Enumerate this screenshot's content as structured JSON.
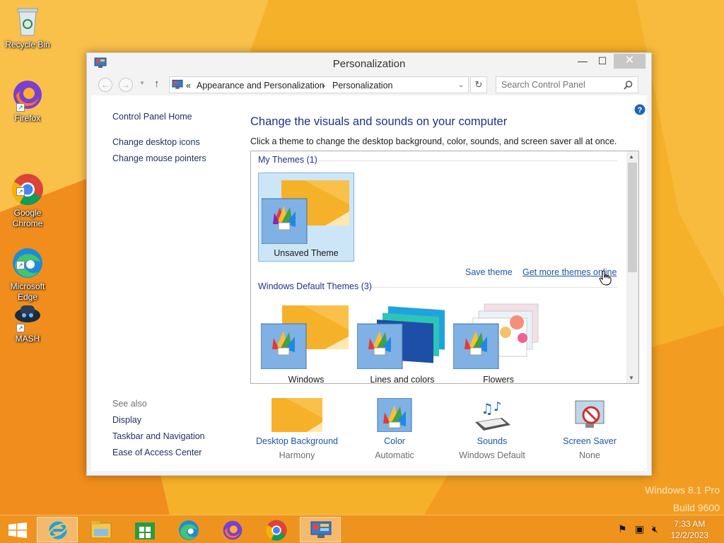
{
  "desktop": {
    "icons": [
      {
        "label": "Recycle Bin"
      },
      {
        "label": "Firefox"
      },
      {
        "label": "Google\nChrome"
      },
      {
        "label": "Microsoft\nEdge"
      },
      {
        "label": "MASH"
      }
    ],
    "watermark_line1": "Windows 8.1 Pro",
    "watermark_line2": "Build 9600"
  },
  "window": {
    "title": "Personalization",
    "close_glyph": "✕",
    "max_glyph": "☐",
    "min_glyph": "—"
  },
  "navbar": {
    "breadcrumb_prefix": "«",
    "crumb_1": "Appearance and Personalization",
    "crumb_sep": "▸",
    "crumb_2": "Personalization",
    "search_placeholder": "Search Control Panel"
  },
  "leftnav": {
    "home": "Control Panel Home",
    "links": [
      "Change desktop icons",
      "Change mouse pointers"
    ],
    "see_also_label": "See also",
    "see_also": [
      "Display",
      "Taskbar and Navigation",
      "Ease of Access Center"
    ]
  },
  "main": {
    "title": "Change the visuals and sounds on your computer",
    "description": "Click a theme to change the desktop background, color, sounds, and screen saver all at once.",
    "my_themes_header": "My Themes (1)",
    "my_themes": [
      {
        "name": "Unsaved Theme",
        "selected": true
      }
    ],
    "save_theme": "Save theme",
    "get_more": "Get more themes online",
    "default_header": "Windows Default Themes (3)",
    "default_themes": [
      {
        "name": "Windows"
      },
      {
        "name": "Lines and colors"
      },
      {
        "name": "Flowers"
      }
    ]
  },
  "bottom": [
    {
      "name": "Desktop Background",
      "value": "Harmony",
      "icon": "desktop-background-icon"
    },
    {
      "name": "Color",
      "value": "Automatic",
      "icon": "color-icon"
    },
    {
      "name": "Sounds",
      "value": "Windows Default",
      "icon": "sounds-icon"
    },
    {
      "name": "Screen Saver",
      "value": "None",
      "icon": "screen-saver-icon"
    }
  ],
  "taskbar": {
    "apps": [
      "start",
      "internet-explorer",
      "file-explorer",
      "store",
      "edge",
      "firefox",
      "chrome",
      "control-panel"
    ],
    "time": "7:33 AM",
    "date": "12/2/2023"
  },
  "colors": {
    "accent": "#f4a81e",
    "link": "#1c56a8",
    "heading": "#1e3287"
  }
}
